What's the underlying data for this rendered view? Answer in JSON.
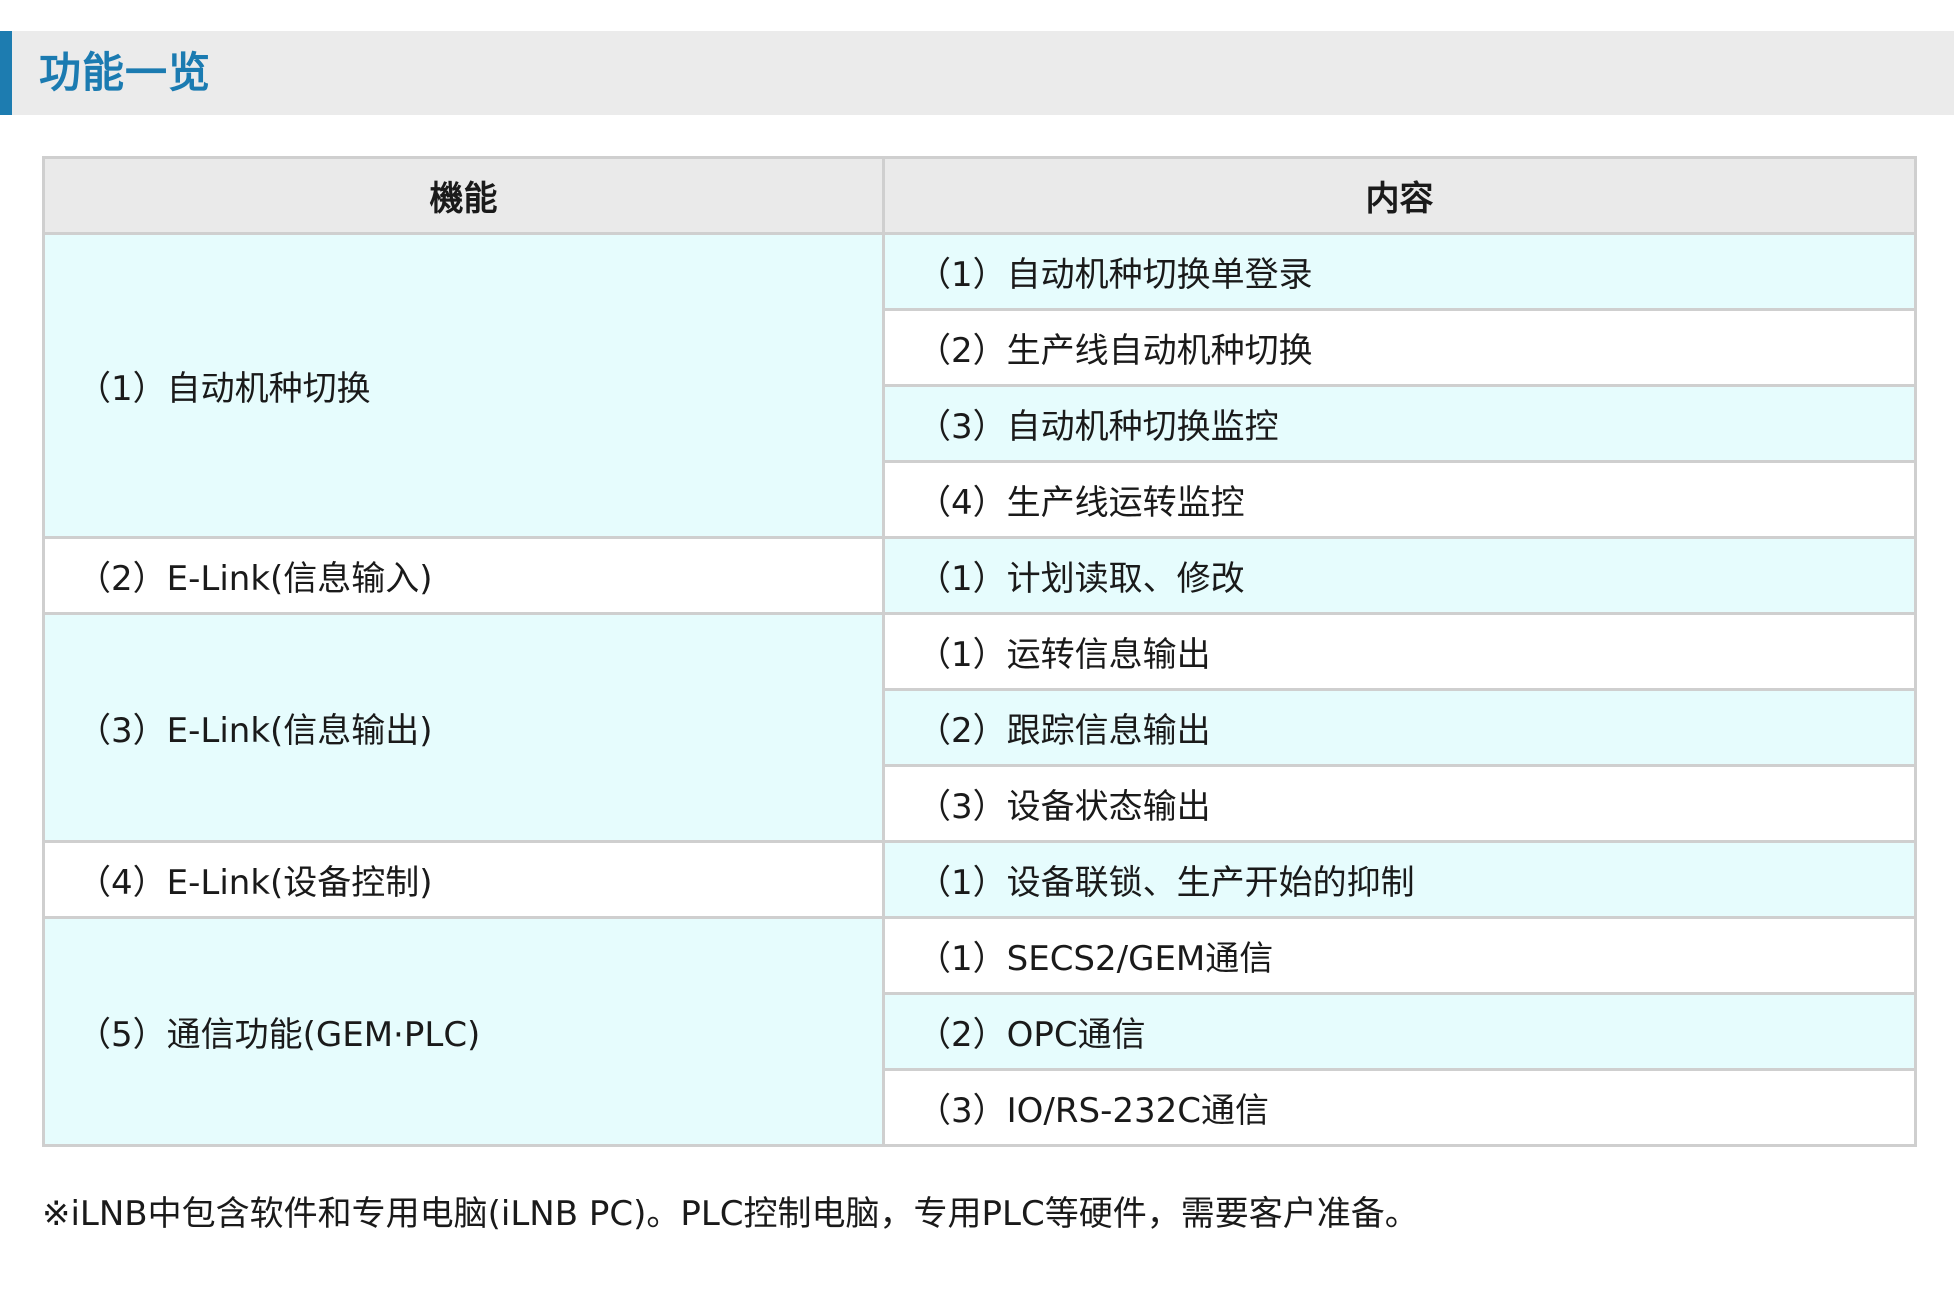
{
  "header": {
    "title": "功能一览"
  },
  "table": {
    "columns": [
      "機能",
      "内容"
    ],
    "groups": [
      {
        "function": "（1）自动机种切换",
        "contents": [
          "（1）自动机种切换单登录",
          "（2）生产线自动机种切换",
          "（3）自动机种切换监控",
          "（4）生产线运转监控"
        ]
      },
      {
        "function": "（2）E-Link(信息输入)",
        "contents": [
          "（1）计划读取、修改"
        ]
      },
      {
        "function": "（3）E-Link(信息输出)",
        "contents": [
          "（1）运转信息输出",
          "（2）跟踪信息输出",
          "（3）设备状态输出"
        ]
      },
      {
        "function": "（4）E-Link(设备控制)",
        "contents": [
          "（1）设备联锁、生产开始的抑制"
        ]
      },
      {
        "function": "（5）通信功能(GEM·PLC)",
        "contents": [
          "（1）SECS2/GEM通信",
          "（2）OPC通信",
          "（3）IO/RS-232C通信"
        ]
      }
    ]
  },
  "note": "※iLNB中包含软件和专用电脑(iLNB PC)。PLC控制电脑，专用PLC等硬件，需要客户准备。",
  "colors": {
    "accent": "#1b7bb1",
    "header_bg": "#ebebeb",
    "row_tint": "#e6fcfd",
    "border": "#cfcfcf"
  }
}
